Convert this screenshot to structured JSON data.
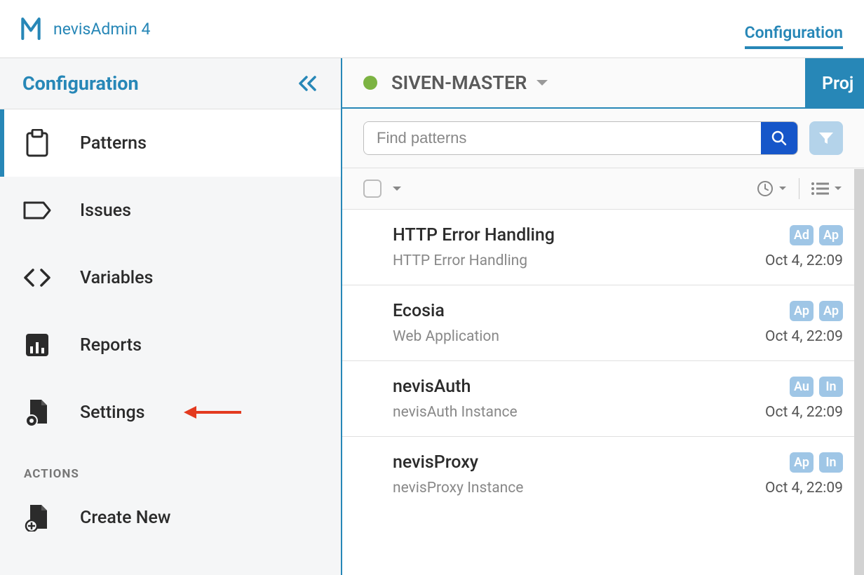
{
  "header": {
    "app_title": "nevisAdmin 4",
    "right_tab": "Configuration"
  },
  "sidebar": {
    "title": "Configuration",
    "items": [
      {
        "label": "Patterns",
        "active": true
      },
      {
        "label": "Issues"
      },
      {
        "label": "Variables"
      },
      {
        "label": "Reports"
      },
      {
        "label": "Settings"
      }
    ],
    "actions_header": "ACTIONS",
    "actions": [
      {
        "label": "Create New"
      }
    ]
  },
  "content": {
    "project_name": "SIVEN-MASTER",
    "proj_tab": "Proj",
    "search_placeholder": "Find patterns",
    "items": [
      {
        "title": "HTTP Error Handling",
        "subtitle": "HTTP Error Handling",
        "date": "Oct 4, 22:09",
        "badges": [
          "Ad",
          "Ap"
        ]
      },
      {
        "title": "Ecosia",
        "subtitle": "Web Application",
        "date": "Oct 4, 22:09",
        "badges": [
          "Ap",
          "Ap"
        ]
      },
      {
        "title": "nevisAuth",
        "subtitle": "nevisAuth Instance",
        "date": "Oct 4, 22:09",
        "badges": [
          "Au",
          "In"
        ]
      },
      {
        "title": "nevisProxy",
        "subtitle": "nevisProxy Instance",
        "date": "Oct 4, 22:09",
        "badges": [
          "Ap",
          "In"
        ]
      }
    ]
  }
}
